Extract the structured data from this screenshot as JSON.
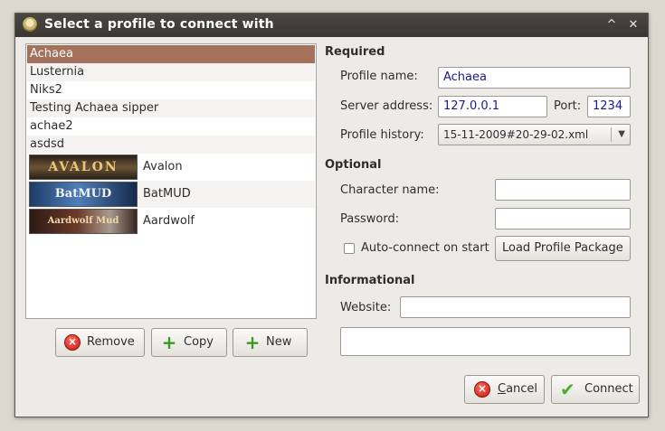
{
  "window": {
    "title": "Select a profile to connect with",
    "min_glyph": "^",
    "close_glyph": "✕"
  },
  "profiles": {
    "text_items": [
      "Achaea",
      "Lusternia",
      "Niks2",
      "Testing Achaea sipper",
      "achae2",
      "asdsd"
    ],
    "image_items": [
      {
        "banner": "AVALON",
        "label": "Avalon"
      },
      {
        "banner": "BatMUD",
        "label": "BatMUD"
      },
      {
        "banner": "Aardwolf Mud",
        "label": "Aardwolf"
      }
    ]
  },
  "list_buttons": {
    "remove": "Remove",
    "copy": "Copy",
    "new": "New"
  },
  "required": {
    "heading": "Required",
    "profile_name_label": "Profile name:",
    "profile_name_value": "Achaea",
    "server_address_label": "Server address:",
    "server_address_value": "127.0.0.1",
    "port_label": "Port:",
    "port_value": "1234",
    "profile_history_label": "Profile history:",
    "profile_history_value": "15-11-2009#20-29-02.xml"
  },
  "optional": {
    "heading": "Optional",
    "character_name_label": "Character name:",
    "character_name_value": "",
    "password_label": "Password:",
    "password_value": "",
    "autoconnect_label": "Auto-connect on start",
    "load_package_label": "Load Profile Package"
  },
  "informational": {
    "heading": "Informational",
    "website_label": "Website:",
    "website_value": "",
    "description_value": ""
  },
  "dialog_buttons": {
    "cancel_mnemonic": "C",
    "cancel_rest": "ancel",
    "connect": "Connect"
  }
}
